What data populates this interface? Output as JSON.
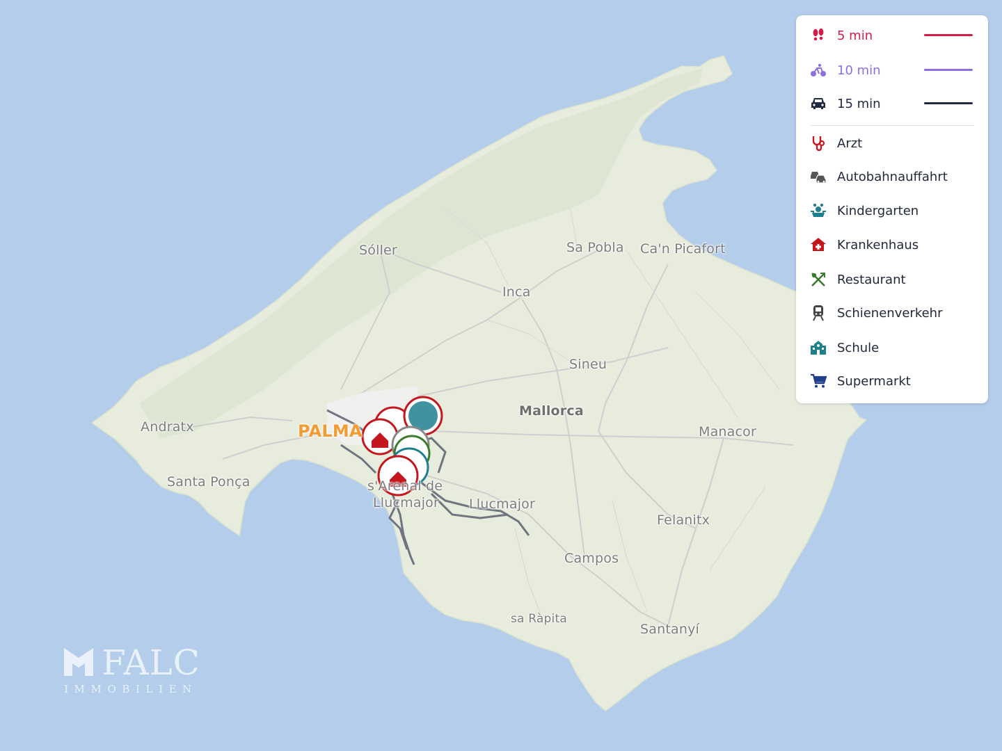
{
  "map": {
    "places": [
      {
        "id": "soller",
        "label": "Sóller"
      },
      {
        "id": "sa-pobla",
        "label": "Sa Pobla"
      },
      {
        "id": "can-picafort",
        "label": "Ca'n Picafort"
      },
      {
        "id": "inca",
        "label": "Inca"
      },
      {
        "id": "sineu",
        "label": "Sineu"
      },
      {
        "id": "mallorca",
        "label": "Mallorca"
      },
      {
        "id": "andratx",
        "label": "Andratx"
      },
      {
        "id": "palma",
        "label": "PALMA"
      },
      {
        "id": "manacor",
        "label": "Manacor"
      },
      {
        "id": "santa-ponca",
        "label": "Santa Ponça"
      },
      {
        "id": "sarenal",
        "label": "s'Arenal de"
      },
      {
        "id": "llucmajor-sub",
        "label": "Llucmajor"
      },
      {
        "id": "llucmajor",
        "label": "Llucmajor"
      },
      {
        "id": "felanitx",
        "label": "Felanitx"
      },
      {
        "id": "campos",
        "label": "Campos"
      },
      {
        "id": "sa-rapita",
        "label": "sa Ràpita"
      },
      {
        "id": "santanyi",
        "label": "Santanyí"
      }
    ]
  },
  "legend": {
    "travel": [
      {
        "label": "5 min",
        "mode": "walking",
        "icon": "footprints-icon",
        "color": "#d11d48"
      },
      {
        "label": "10 min",
        "mode": "cycling",
        "icon": "bicycle-icon",
        "color": "#8f6fe0"
      },
      {
        "label": "15 min",
        "mode": "driving",
        "icon": "car-icon",
        "color": "#1f2a40"
      }
    ],
    "categories": [
      {
        "label": "Arzt",
        "icon": "stethoscope-icon",
        "color": "#c4161c"
      },
      {
        "label": "Autobahnauffahrt",
        "icon": "highway-icon",
        "color": "#555555"
      },
      {
        "label": "Kindergarten",
        "icon": "kindergarten-icon",
        "color": "#1e7f8f"
      },
      {
        "label": "Krankenhaus",
        "icon": "hospital-icon",
        "color": "#c4161c"
      },
      {
        "label": "Restaurant",
        "icon": "cutlery-icon",
        "color": "#3a7a2e"
      },
      {
        "label": "Schienenverkehr",
        "icon": "train-icon",
        "color": "#444444"
      },
      {
        "label": "Schule",
        "icon": "school-icon",
        "color": "#1e7f8f"
      },
      {
        "label": "Supermarkt",
        "icon": "cart-icon",
        "color": "#1f3d8a"
      }
    ]
  },
  "watermark": {
    "name": "FALC",
    "sub": "IMMOBILIEN"
  }
}
